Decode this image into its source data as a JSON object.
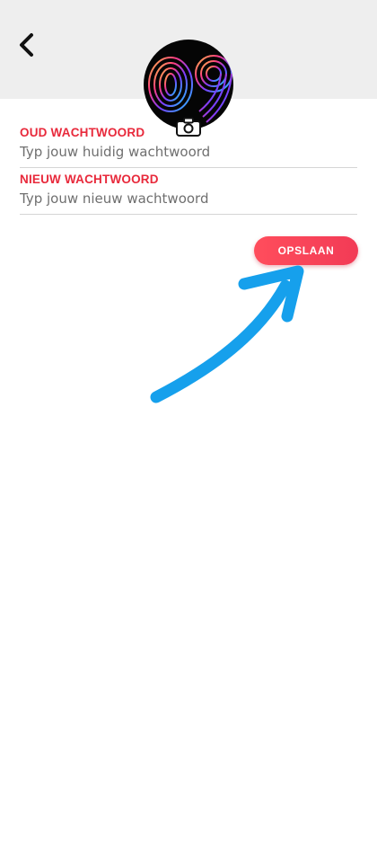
{
  "colors": {
    "accent": "#e8293b",
    "button_gradient_start": "#ff4d5c",
    "button_gradient_end": "#f23b56",
    "header_bg": "#eeeeee",
    "annotation_arrow": "#16a0ec"
  },
  "header": {
    "back_icon": "chevron-left-icon"
  },
  "avatar": {
    "text": "09",
    "camera_icon": "camera-icon"
  },
  "form": {
    "old_password": {
      "label": "OUD WACHTWOORD",
      "placeholder": "Typ jouw huidig wachtwoord",
      "value": ""
    },
    "new_password": {
      "label": "NIEUW WACHTWOORD",
      "placeholder": "Typ jouw nieuw wachtwoord",
      "value": ""
    }
  },
  "actions": {
    "save_label": "OPSLAAN"
  }
}
